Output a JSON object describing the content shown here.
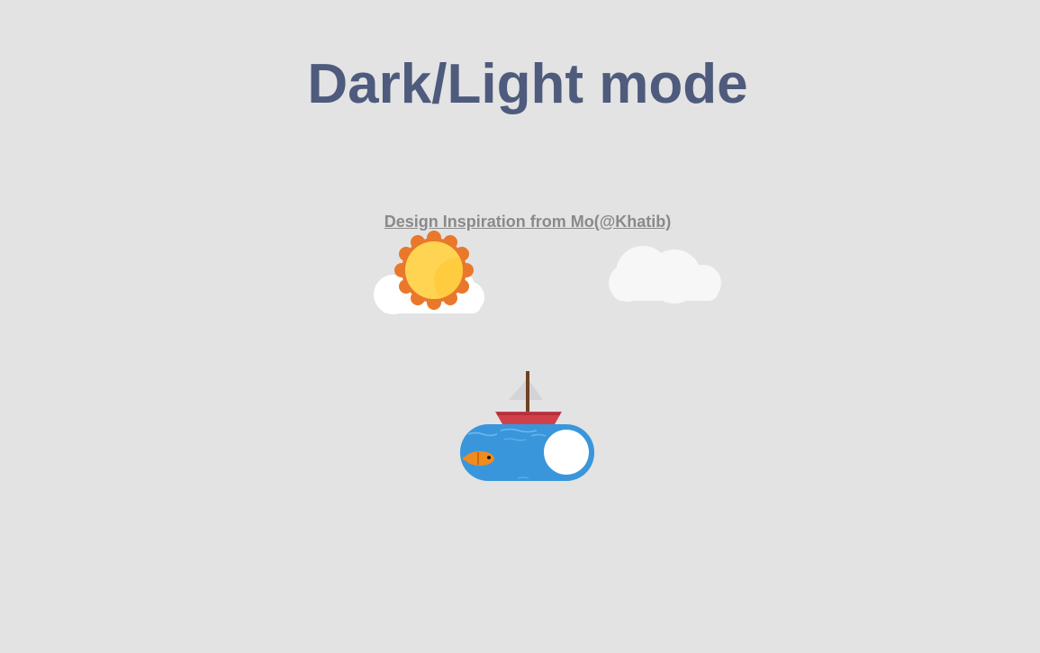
{
  "page": {
    "title": "Dark/Light mode",
    "credit_link": "Design Inspiration from Mo(@Khatib)"
  },
  "theme_toggle": {
    "mode": "light"
  },
  "colors": {
    "background": "#e3e3e4",
    "title": "#4f5b7c",
    "credit": "#8a8a8a",
    "sun_inner": "#ffd452",
    "sun_outer": "#e9782b",
    "cloud": "#ffffff",
    "water": "#3a96db",
    "boat_hull": "#d1404a",
    "boat_mast": "#6e4224",
    "sail": "#d2d2d4",
    "fish": "#f08b1e",
    "knob": "#ffffff"
  },
  "icons": [
    "sun-icon",
    "cloud-icon",
    "boat-icon",
    "fish-icon"
  ]
}
